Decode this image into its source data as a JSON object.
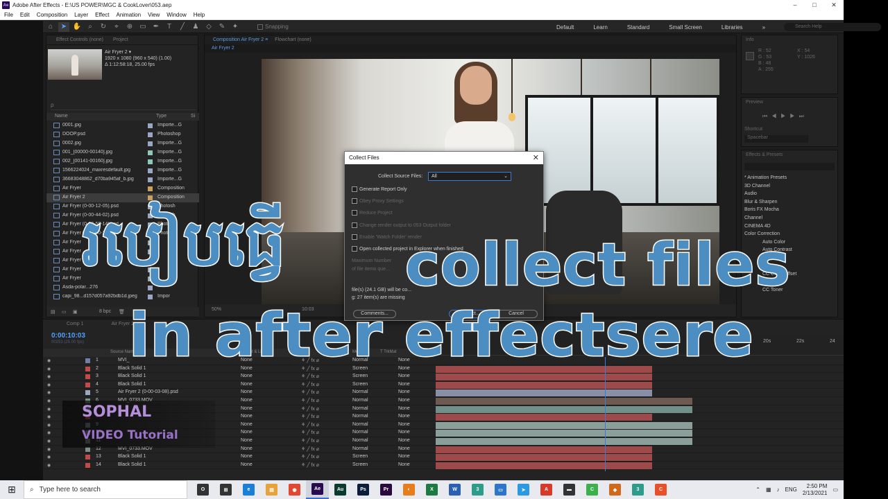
{
  "window": {
    "title": "Adobe After Effects - E:\\US POWER\\MGC & CookLover\\053.aep",
    "logo": "Ae",
    "controls": [
      "–",
      "□",
      "✕"
    ]
  },
  "menu": [
    "File",
    "Edit",
    "Composition",
    "Layer",
    "Effect",
    "Animation",
    "View",
    "Window",
    "Help"
  ],
  "toolbar": {
    "snapping_label": "Snapping",
    "workspaces": [
      "Default",
      "Learn",
      "Standard",
      "Small Screen",
      "Libraries"
    ],
    "more": "»",
    "search_placeholder": "Search Help"
  },
  "project": {
    "tabs": [
      "Effect Controls (none)",
      "Project"
    ],
    "comp_name": "Air Fryer 2 ▾",
    "comp_info": [
      "1920 x 1080  (960 x 540) (1.00)",
      "Δ 1:12:58:18, 25.00 fps"
    ],
    "search": "ρ",
    "col_name": "Name",
    "col_type": "Type",
    "col_size": "Si",
    "items": [
      {
        "name": "0001.jpg",
        "type": "Importe...G",
        "color": "#9aa7c4"
      },
      {
        "name": "DOOP.psd",
        "type": "Photoshop",
        "color": "#9aa7c4"
      },
      {
        "name": "0002.jpg",
        "type": "Importe...G",
        "color": "#9aa7c4"
      },
      {
        "name": "001_[00000-00140].jpg",
        "type": "Importe...G",
        "color": "#8fc7b8"
      },
      {
        "name": "002_[00141-00160].jpg",
        "type": "Importe...G",
        "color": "#8fc7b8"
      },
      {
        "name": "1566224024_maxresdefault.jpg",
        "type": "Importe...G",
        "color": "#9aa7c4"
      },
      {
        "name": "36683048862_d70ba945af_b.jpg",
        "type": "Importe...G",
        "color": "#9aa7c4"
      },
      {
        "name": "Air Fryer",
        "type": "Composition",
        "color": "#c9a15a"
      },
      {
        "name": "Air Fryer 2",
        "type": "Composition",
        "color": "#c9a15a"
      },
      {
        "name": "Air Fryer (0-00-12-05).psd",
        "type": "Photosh",
        "color": "#9aa7c4"
      },
      {
        "name": "Air Fryer (0-00-44-02).psd",
        "type": "Photosh",
        "color": "#9aa7c4"
      },
      {
        "name": "Air Fryer (0-00-58-14).psd",
        "type": "Photosh",
        "color": "#9aa7c4"
      },
      {
        "name": "Air Fryer (0-01-00-23).psd",
        "type": "Photosh",
        "color": "#9aa7c4"
      },
      {
        "name": "Air Fryer",
        "type": "",
        "color": "#9aa7c4"
      },
      {
        "name": "Air Fryer",
        "type": "",
        "color": "#9aa7c4"
      },
      {
        "name": "Air Fryer",
        "type": "",
        "color": "#9aa7c4"
      },
      {
        "name": "Air Fryer",
        "type": "",
        "color": "#9aa7c4"
      },
      {
        "name": "Air Fryer",
        "type": "",
        "color": "#9aa7c4"
      },
      {
        "name": "Asda-polar...276",
        "type": "",
        "color": "#9aa7c4"
      },
      {
        "name": "capi_98...d157d057a92bdb1d.jpeg",
        "type": "Impor",
        "color": "#9aa7c4"
      }
    ],
    "footer_bpc": "8 bpc"
  },
  "comp": {
    "tabs": [
      "Composition Air Fryer 2 ≡",
      "Flowchart (none)"
    ],
    "crumb": "Air Fryer 2",
    "zoom": "50%",
    "timecode": "10:03"
  },
  "right": {
    "info_title": "Info",
    "info_values": [
      "R : 52",
      "G : 53",
      "B : 48",
      "A : 255",
      "X : 54",
      "Y : 1026"
    ],
    "preview_title": "Preview",
    "shortcut_label": "Shortcut",
    "shortcut_value": "Spacebar",
    "effects_title": "Effects & Presets",
    "effects": [
      "* Animation Presets",
      "3D Channel",
      "Audio",
      "Blur & Sharpen",
      "Boris FX Mocha",
      "Channel",
      "CINEMA 4D",
      "Color Correction"
    ],
    "effects_sub": [
      "Auto Color",
      "Auto Contrast",
      "",
      "",
      "Contrast",
      "",
      "nizer",
      "CC Color Offset",
      "CC Kernel",
      "CC Toner"
    ]
  },
  "timeline": {
    "tabs": [
      "Comp 1",
      "Air Fryer 2"
    ],
    "timecode": "0:00:10:03",
    "fps": "00253 (25.00 fps)",
    "head": [
      "Source Name",
      "Mode",
      "T TrkMat",
      "Parent & Link"
    ],
    "ruler": [
      "20s",
      "22s",
      "24"
    ],
    "layers": [
      {
        "num": "1",
        "name": "MVI_",
        "mode": "Normal",
        "parent": "None",
        "color": "#6f7fa8",
        "bar": "#7c8f8a",
        "start": 0,
        "end": 0
      },
      {
        "num": "2",
        "name": "Black Solid 1",
        "mode": "Screen",
        "parent": "None",
        "color": "#c24a4a",
        "bar": "#9e4a4a",
        "start": 0,
        "end": 0.53
      },
      {
        "num": "3",
        "name": "Black Solid 1",
        "mode": "Screen",
        "parent": "None",
        "color": "#c24a4a",
        "bar": "#9e4a4a",
        "start": 0,
        "end": 0.53
      },
      {
        "num": "4",
        "name": "Black Solid 1",
        "mode": "Screen",
        "parent": "None",
        "color": "#c24a4a",
        "bar": "#9e4a4a",
        "start": 0,
        "end": 0.53
      },
      {
        "num": "5",
        "name": "Air Fryer 2 (0-00-03-08).psd",
        "mode": "Normal",
        "parent": "None",
        "color": "#9aa7c4",
        "bar": "#8a8fa8",
        "start": 0,
        "end": 0.53
      },
      {
        "num": "6",
        "name": "MVI_0733.MOV",
        "mode": "Normal",
        "parent": "None",
        "color": "#7c8f8a",
        "bar": "#6f5a52",
        "start": 0,
        "end": 0.63
      },
      {
        "num": "7",
        "name": "",
        "mode": "Normal",
        "parent": "None",
        "color": "#7c8f8a",
        "bar": "#728f8a",
        "start": 0,
        "end": 0.63
      },
      {
        "num": "8",
        "name": "",
        "mode": "Normal",
        "parent": "None",
        "color": "#c24a4a",
        "bar": "#9e4a4a",
        "start": 0,
        "end": 0.53
      },
      {
        "num": "9",
        "name": "",
        "mode": "Normal",
        "parent": "None",
        "color": "#7c8f8a",
        "bar": "#8a9e9a",
        "start": 0,
        "end": 0.63
      },
      {
        "num": "10",
        "name": "",
        "mode": "Normal",
        "parent": "None",
        "color": "#7c8f8a",
        "bar": "#8a9e9a",
        "start": 0,
        "end": 0.63
      },
      {
        "num": "11",
        "name": "",
        "mode": "Normal",
        "parent": "None",
        "color": "#7c8f8a",
        "bar": "#8a9e9a",
        "start": 0,
        "end": 0.63
      },
      {
        "num": "12",
        "name": "MVI_0733.MOV",
        "mode": "Normal",
        "parent": "None",
        "color": "#7c8f8a",
        "bar": "#9e4a4a",
        "start": 0,
        "end": 0.53
      },
      {
        "num": "13",
        "name": "Black Solid 1",
        "mode": "Screen",
        "parent": "None",
        "color": "#c24a4a",
        "bar": "#9e4a4a",
        "start": 0,
        "end": 0.53
      },
      {
        "num": "14",
        "name": "Black Solid 1",
        "mode": "Screen",
        "parent": "None",
        "color": "#c24a4a",
        "bar": "#9e4a4a",
        "start": 0,
        "end": 0.53
      }
    ]
  },
  "dialog": {
    "title": "Collect Files",
    "close": "✕",
    "source_label": "Collect Source Files:",
    "source_value": "All",
    "options": [
      "Generate Report Only",
      "Obey Proxy Settings",
      "Reduce Project",
      "Change render output to  053 Output  folder",
      "Enable 'Watch Folder' render",
      "Open collected project in Explorer when finished",
      "Maximum Number",
      "of file items que..."
    ],
    "info_lines": [
      "file(s) (24.1 GB) will be co...",
      "g: 27 item(s) are missing"
    ],
    "comments_btn": "Comments...",
    "collect_btn": "Collect...",
    "cancel_btn": "Cancel"
  },
  "overlay": {
    "khmer": "របៀបធ្វើ",
    "line1": "collect files",
    "line2": "in after effectsere",
    "color": "#4d8ec2"
  },
  "brand": {
    "name": "SOPHAL",
    "tagline": "VIDEO Tutorial"
  },
  "taskbar": {
    "search_placeholder": "Type here to search",
    "apps": [
      {
        "label": "O",
        "color": "#333333"
      },
      {
        "label": "⊞",
        "color": "#333333"
      },
      {
        "label": "e",
        "color": "#1a7fd6"
      },
      {
        "label": "▤",
        "color": "#e8a23a"
      },
      {
        "label": "◉",
        "color": "#e0492f"
      },
      {
        "label": "Ae",
        "color": "#2a0a4e"
      },
      {
        "label": "Au",
        "color": "#0b3b2e"
      },
      {
        "label": "Ps",
        "color": "#0b1e3a"
      },
      {
        "label": "Pr",
        "color": "#2a0a3e"
      },
      {
        "label": "◐",
        "color": "#e87d1e"
      },
      {
        "label": "X",
        "color": "#1d7a44"
      },
      {
        "label": "W",
        "color": "#2b5fb4"
      },
      {
        "label": "3",
        "color": "#2e9c8a"
      },
      {
        "label": "▭",
        "color": "#2f76c8"
      },
      {
        "label": "➤",
        "color": "#2c9ae0"
      },
      {
        "label": "A",
        "color": "#d83a2a"
      },
      {
        "label": "▬",
        "color": "#333333"
      },
      {
        "label": "C",
        "color": "#3cb04a"
      },
      {
        "label": "◆",
        "color": "#d06a1a"
      },
      {
        "label": "3",
        "color": "#2e9c8a"
      },
      {
        "label": "C",
        "color": "#e8502a"
      }
    ],
    "lang": "ENG",
    "time": "2:50 PM",
    "date": "2/13/2021"
  }
}
